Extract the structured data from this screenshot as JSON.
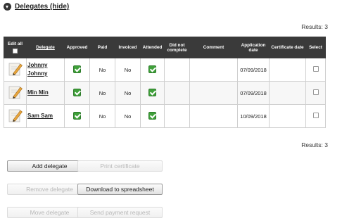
{
  "section": {
    "title": "Delegates (hide)"
  },
  "results": {
    "top": "Results: 3",
    "bottom": "Results: 3"
  },
  "table": {
    "headers": {
      "edit_all": "Edit all",
      "delegate": "Delegate",
      "approved": "Approved",
      "paid": "Paid",
      "invoiced": "Invoiced",
      "attended": "Attended",
      "did_not_complete": "Did not complete",
      "comment": "Comment",
      "application_date": "Application date",
      "certificate_date": "Certificate date",
      "select": "Select"
    },
    "rows": [
      {
        "name": "Johnny Johnny",
        "approved": true,
        "paid": "No",
        "invoiced": "No",
        "attended": true,
        "did_not_complete": "",
        "comment": "",
        "application_date": "07/09/2018",
        "certificate_date": "",
        "selected": false
      },
      {
        "name": "Min Min",
        "approved": true,
        "paid": "No",
        "invoiced": "No",
        "attended": true,
        "did_not_complete": "",
        "comment": "",
        "application_date": "07/09/2018",
        "certificate_date": "",
        "selected": false
      },
      {
        "name": "Sam Sam",
        "approved": true,
        "paid": "No",
        "invoiced": "No",
        "attended": true,
        "did_not_complete": "",
        "comment": "",
        "application_date": "10/09/2018",
        "certificate_date": "",
        "selected": false
      }
    ]
  },
  "buttons": {
    "add_delegate": "Add delegate",
    "print_certificate": "Print certificate",
    "remove_delegate": "Remove delegate",
    "download_spreadsheet": "Download to spreadsheet",
    "move_delegate": "Move delegate",
    "send_payment_request": "Send payment request"
  },
  "icons": {
    "toggle": "collapse-toggle-icon",
    "edit": "edit-pencil-icon",
    "approved": "checkmark-icon"
  },
  "colors": {
    "header_bg": "#3a3a3a",
    "tick_green": "#3fa03a"
  }
}
